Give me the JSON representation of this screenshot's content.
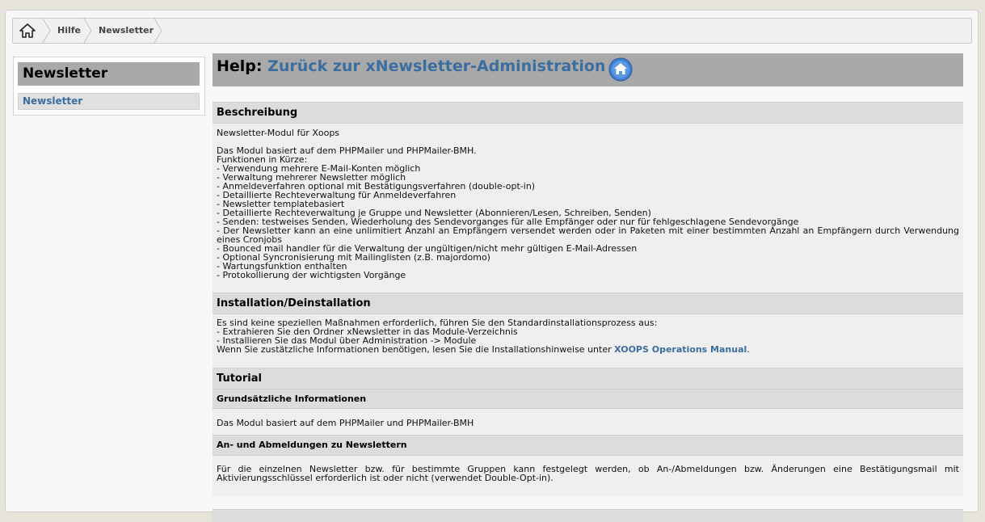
{
  "breadcrumb": {
    "home_icon": "home-icon",
    "items": [
      "Hilfe",
      "Newsletter"
    ]
  },
  "sidebar": {
    "title": "Newsletter",
    "link": "Newsletter"
  },
  "help": {
    "prefix": "Help:",
    "link_text": "Zurück zur xNewsletter-Administration",
    "home_icon": "home-circle-icon"
  },
  "sections": {
    "beschreibung": {
      "title": "Beschreibung",
      "intro": "Newsletter-Modul für Xoops",
      "lines": [
        "Das Modul basiert auf dem PHPMailer und PHPMailer-BMH.",
        "Funktionen in Kürze:",
        "- Verwendung mehrere E-Mail-Konten möglich",
        "- Verwaltung mehrerer Newsletter möglich",
        "- Anmeldeverfahren optional mit Bestätigungsverfahren (double-opt-in)",
        "- Detaillierte Rechteverwaltung für Anmeldeverfahren",
        "- Newsletter templatebasiert",
        "- Detaillierte Rechteverwaltung je Gruppe und Newsletter (Abonnieren/Lesen, Schreiben, Senden)",
        "- Senden: testweises Senden, Wiederholung des Sendevorganges für alle Empfänger oder nur für fehlgeschlagene Sendevorgänge",
        "- Der Newsletter kann an eine unlimitiert Anzahl an Empfängern versendet werden oder in Paketen mit einer bestimmten Anzahl an Empfängern durch Verwendung eines Cronjobs",
        "- Bounced mail handler für die Verwaltung der ungültigen/nicht mehr gültigen E-Mail-Adressen",
        "- Optional Syncronisierung mit Mailinglisten (z.B. majordomo)",
        "- Wartungsfunktion enthalten",
        "- Protokollierung der wichtigsten Vorgänge"
      ]
    },
    "installation": {
      "title": "Installation/Deinstallation",
      "lines": [
        "Es sind keine speziellen Maßnahmen erforderlich, führen Sie den Standardinstallationsprozess aus:",
        "- Extrahieren Sie den Ordner xNewsletter in das Module-Verzeichnis",
        "- Installieren Sie das Modul über Administration -> Module"
      ],
      "last_line_prefix": "Wenn Sie zustätzliche Informationen benötigen, lesen Sie die Installationshinweise unter ",
      "manual_link": "XOOPS Operations Manual",
      "last_line_suffix": "."
    },
    "tutorial": {
      "title": "Tutorial",
      "sub1_title": "Grundsätzliche Informationen",
      "sub1_text": "Das Modul basiert auf dem PHPMailer und PHPMailer-BMH",
      "sub2_title": "An- und Abmeldungen zu Newslettern",
      "sub2_text": "Für die einzelnen Newsletter bzw. für bestimmte Gruppen kann festgelegt werden, ob An-/Abmeldungen bzw. Änderungen eine Bestätigungsmail mit Aktivierungsschlüssel erforderlich ist oder nicht (verwendet Double-Opt-in)."
    }
  }
}
